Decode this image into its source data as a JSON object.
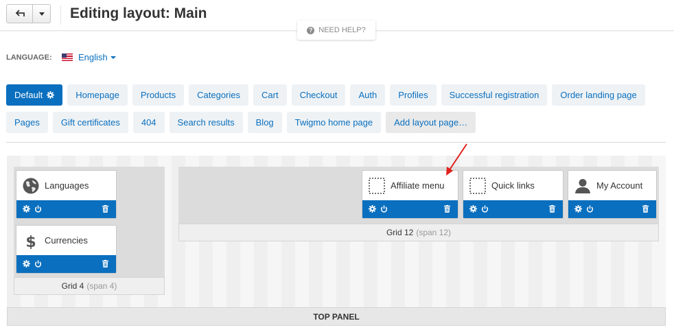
{
  "header": {
    "title": "Editing layout: Main",
    "help_label": "NEED HELP?"
  },
  "language": {
    "label": "LANGUAGE:",
    "value": "English"
  },
  "tabs_row1": [
    {
      "label": "Default"
    },
    {
      "label": "Homepage"
    },
    {
      "label": "Products"
    },
    {
      "label": "Categories"
    },
    {
      "label": "Cart"
    },
    {
      "label": "Checkout"
    },
    {
      "label": "Auth"
    },
    {
      "label": "Profiles"
    },
    {
      "label": "Successful registration"
    },
    {
      "label": "Order landing page"
    }
  ],
  "tabs_row2": [
    {
      "label": "Pages"
    },
    {
      "label": "Gift certificates"
    },
    {
      "label": "404"
    },
    {
      "label": "Search results"
    },
    {
      "label": "Blog"
    },
    {
      "label": "Twigmo home page"
    },
    {
      "label": "Add layout page…"
    }
  ],
  "grids": {
    "grid4": {
      "name": "Grid 4",
      "span": "(span 4)"
    },
    "grid12": {
      "name": "Grid 12",
      "span": "(span 12)"
    }
  },
  "blocks": {
    "languages": "Languages",
    "currencies": "Currencies",
    "affiliate": "Affiliate menu",
    "quick_links": "Quick links",
    "my_account": "My Account"
  },
  "panel": {
    "title": "TOP PANEL"
  },
  "colors": {
    "accent": "#0a6fbe",
    "annotation_arrow": "#e0201b"
  }
}
